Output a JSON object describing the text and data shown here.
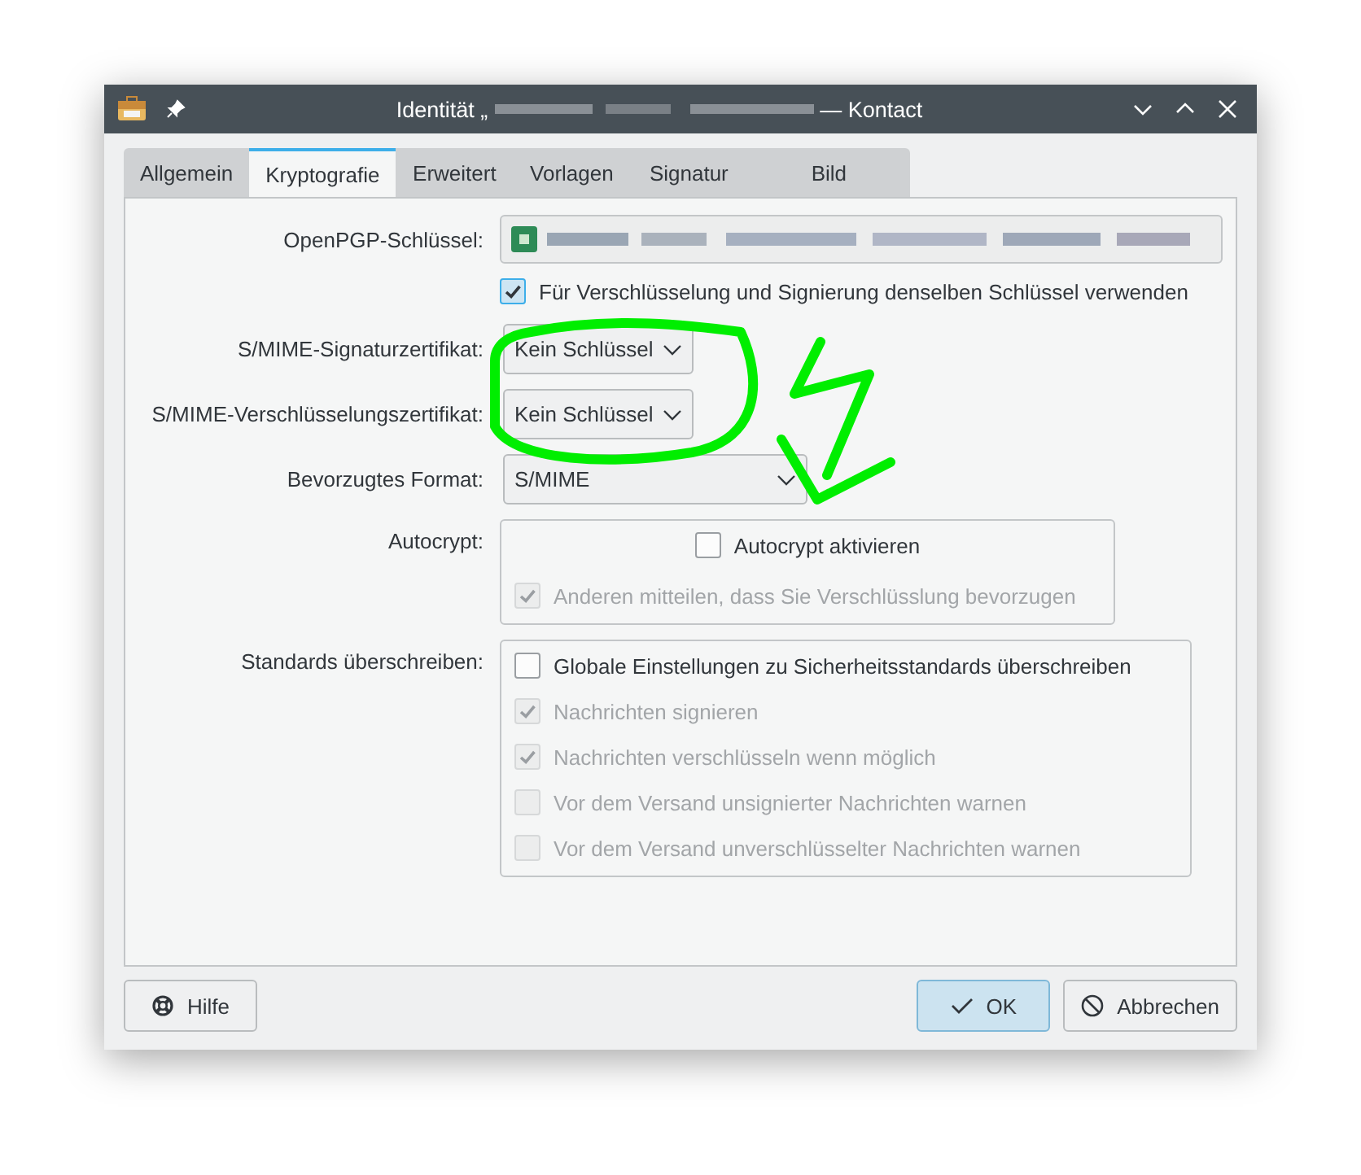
{
  "window": {
    "title_start": "Identität „",
    "title_end": "— Kontact"
  },
  "tabs": [
    {
      "label": "Allgemein",
      "selected": false
    },
    {
      "label": "Kryptografie",
      "selected": true
    },
    {
      "label": "Erweitert",
      "selected": false
    },
    {
      "label": "Vorlagen",
      "selected": false
    },
    {
      "label": "Signatur",
      "selected": false
    },
    {
      "label": "Bild",
      "selected": false
    }
  ],
  "openpgp": {
    "label": "OpenPGP-Schlüssel:"
  },
  "same_key": {
    "label": "Für Verschlüsselung und Signierung denselben Schlüssel verwenden",
    "checked": true
  },
  "combos": [
    {
      "label": "S/MIME-Signaturzertifikat:",
      "value": "Kein Schlüssel",
      "wide": false
    },
    {
      "label": "S/MIME-Verschlüsselungszertifikat:",
      "value": "Kein Schlüssel",
      "wide": false
    },
    {
      "label": "Bevorzugtes Format:",
      "value": "S/MIME",
      "wide": true
    }
  ],
  "autocrypt": {
    "label": "Autocrypt:",
    "enable": {
      "label": "Autocrypt aktivieren",
      "checked": false,
      "disabled": false
    },
    "options": [
      {
        "label": "Anderen mitteilen, dass Sie Verschlüsslung bevorzugen",
        "checked": true,
        "disabled": true
      }
    ]
  },
  "standards": {
    "label": "Standards überschreiben:",
    "override": {
      "label": "Globale Einstellungen zu Sicherheitsstandards überschreiben",
      "checked": false,
      "disabled": false
    },
    "options": [
      {
        "label": "Nachrichten signieren",
        "checked": true,
        "disabled": true
      },
      {
        "label": "Nachrichten verschlüsseln wenn möglich",
        "checked": true,
        "disabled": true
      },
      {
        "label": "Vor dem Versand unsignierter Nachrichten warnen",
        "checked": false,
        "disabled": true
      },
      {
        "label": "Vor dem Versand unverschlüsselter Nachrichten warnen",
        "checked": false,
        "disabled": true
      }
    ]
  },
  "buttons": [
    {
      "label": "Hilfe",
      "kind": "help"
    },
    {
      "label": "OK",
      "kind": "ok"
    },
    {
      "label": "Abbrechen",
      "kind": "cancel"
    }
  ]
}
